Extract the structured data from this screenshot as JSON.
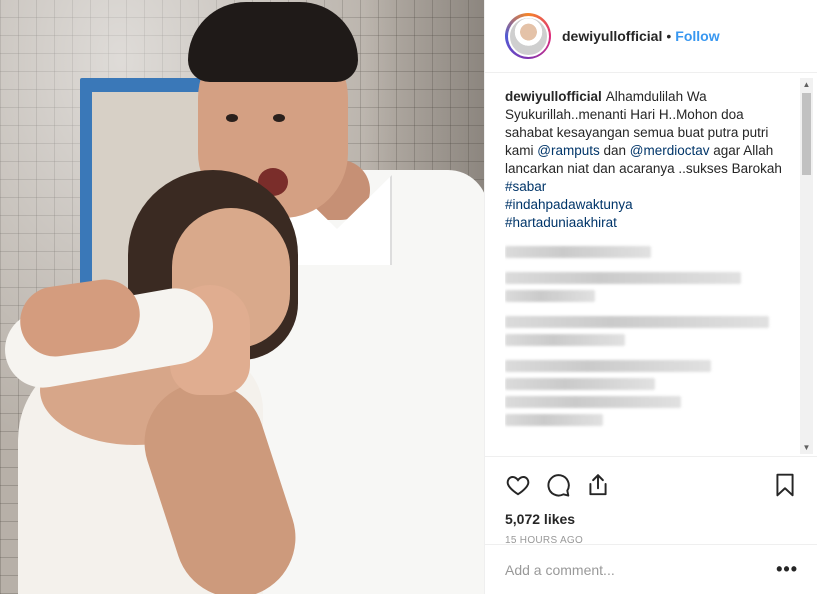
{
  "post": {
    "username": "dewiyullofficial",
    "separator": "•",
    "follow_label": "Follow"
  },
  "caption": {
    "username": "dewiyullofficial",
    "text_1": "Alhamdulilah Wa Syukurillah..menanti Hari H..Mohon doa sahabat kesayangan semua buat putra putri kami ",
    "mention_1": "@ramputs",
    "text_2": " dan ",
    "mention_2": "@merdioctav",
    "text_3": " agar Allah lancarkan niat dan acaranya ..sukses Barokah",
    "hashtags": [
      "#sabar",
      "#indahpadawaktunya",
      "#hartaduniaakhirat"
    ]
  },
  "icons": {
    "like": "heart-icon",
    "comment": "comment-icon",
    "share": "share-icon",
    "save": "bookmark-icon",
    "more": "more-options-icon"
  },
  "stats": {
    "likes": "5,072 likes",
    "time_ago": "15 HOURS AGO"
  },
  "comment_box": {
    "placeholder": "Add a comment...",
    "more_label": "•••"
  },
  "colors": {
    "link": "#3897f0",
    "mention": "#003569",
    "text": "#262626",
    "muted": "#999999"
  }
}
